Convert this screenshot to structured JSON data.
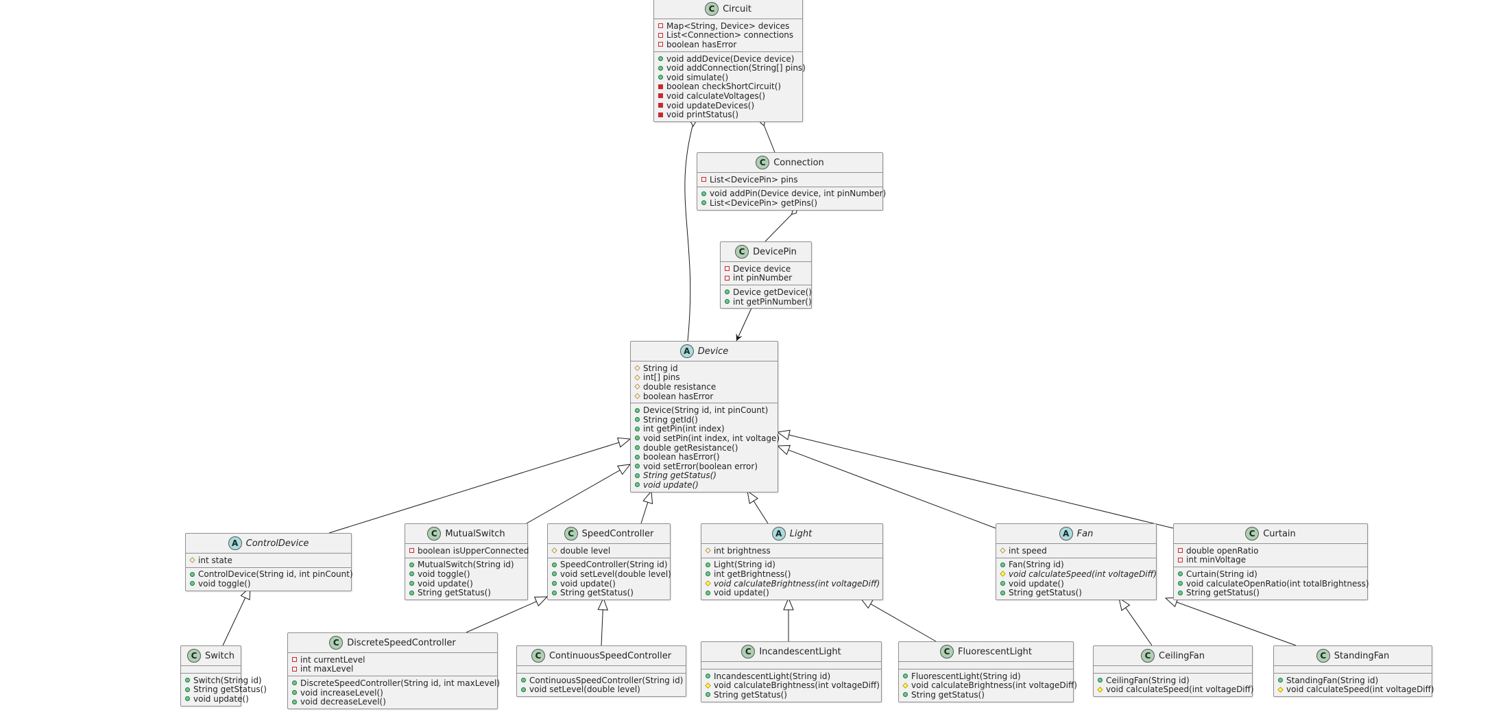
{
  "colors": {
    "class_badge": "#add1b2",
    "abstract_badge": "#a9dcdf",
    "box_fill": "#f1f1f1",
    "border": "#8f8f8f",
    "private": "#c82930",
    "public": "#84be84",
    "protected": "#b38d22"
  },
  "classes": [
    {
      "name": "Circuit",
      "kind": "class",
      "badge": "C",
      "fields": [
        {
          "vis": "private",
          "text": "Map<String, Device> devices"
        },
        {
          "vis": "private",
          "text": "List<Connection> connections"
        },
        {
          "vis": "private",
          "text": "boolean hasError"
        }
      ],
      "methods": [
        {
          "vis": "public",
          "text": "void addDevice(Device device)"
        },
        {
          "vis": "public",
          "text": "void addConnection(String[] pins)"
        },
        {
          "vis": "public",
          "text": "void simulate()"
        },
        {
          "vis": "private",
          "text": "boolean checkShortCircuit()"
        },
        {
          "vis": "private",
          "text": "void calculateVoltages()"
        },
        {
          "vis": "private",
          "text": "void updateDevices()"
        },
        {
          "vis": "private",
          "text": "void printStatus()"
        }
      ]
    },
    {
      "name": "Connection",
      "kind": "class",
      "badge": "C",
      "fields": [
        {
          "vis": "private",
          "text": "List<DevicePin> pins"
        }
      ],
      "methods": [
        {
          "vis": "public",
          "text": "void addPin(Device device, int pinNumber)"
        },
        {
          "vis": "public",
          "text": "List<DevicePin> getPins()"
        }
      ]
    },
    {
      "name": "DevicePin",
      "kind": "class",
      "badge": "C",
      "fields": [
        {
          "vis": "private",
          "text": "Device device"
        },
        {
          "vis": "private",
          "text": "int pinNumber"
        }
      ],
      "methods": [
        {
          "vis": "public",
          "text": "Device getDevice()"
        },
        {
          "vis": "public",
          "text": "int getPinNumber()"
        }
      ]
    },
    {
      "name": "Device",
      "kind": "abstract",
      "badge": "A",
      "fields": [
        {
          "vis": "protected",
          "text": "String id"
        },
        {
          "vis": "protected",
          "text": "int[] pins"
        },
        {
          "vis": "protected",
          "text": "double resistance"
        },
        {
          "vis": "protected",
          "text": "boolean hasError"
        }
      ],
      "methods": [
        {
          "vis": "public",
          "text": "Device(String id, int pinCount)"
        },
        {
          "vis": "public",
          "text": "String getId()"
        },
        {
          "vis": "public",
          "text": "int getPin(int index)"
        },
        {
          "vis": "public",
          "text": "void setPin(int index, int voltage)"
        },
        {
          "vis": "public",
          "text": "double getResistance()"
        },
        {
          "vis": "public",
          "text": "boolean hasError()"
        },
        {
          "vis": "public",
          "text": "void setError(boolean error)"
        },
        {
          "vis": "public",
          "text": "String getStatus()",
          "abstract": true
        },
        {
          "vis": "public",
          "text": "void update()",
          "abstract": true
        }
      ]
    },
    {
      "name": "ControlDevice",
      "kind": "abstract",
      "badge": "A",
      "fields": [
        {
          "vis": "protected",
          "text": "int state"
        }
      ],
      "methods": [
        {
          "vis": "public",
          "text": "ControlDevice(String id, int pinCount)"
        },
        {
          "vis": "public",
          "text": "void toggle()"
        }
      ]
    },
    {
      "name": "MutualSwitch",
      "kind": "class",
      "badge": "C",
      "fields": [
        {
          "vis": "private",
          "text": "boolean isUpperConnected"
        }
      ],
      "methods": [
        {
          "vis": "public",
          "text": "MutualSwitch(String id)"
        },
        {
          "vis": "public",
          "text": "void toggle()"
        },
        {
          "vis": "public",
          "text": "void update()"
        },
        {
          "vis": "public",
          "text": "String getStatus()"
        }
      ]
    },
    {
      "name": "SpeedController",
      "kind": "class",
      "badge": "C",
      "fields": [
        {
          "vis": "protected",
          "text": "double level"
        }
      ],
      "methods": [
        {
          "vis": "public",
          "text": "SpeedController(String id)"
        },
        {
          "vis": "public",
          "text": "void setLevel(double level)"
        },
        {
          "vis": "public",
          "text": "void update()"
        },
        {
          "vis": "public",
          "text": "String getStatus()"
        }
      ]
    },
    {
      "name": "Light",
      "kind": "abstract",
      "badge": "A",
      "fields": [
        {
          "vis": "protected",
          "text": "int brightness"
        }
      ],
      "methods": [
        {
          "vis": "public",
          "text": "Light(String id)"
        },
        {
          "vis": "public",
          "text": "int getBrightness()"
        },
        {
          "vis": "protected",
          "text": "void calculateBrightness(int voltageDiff)",
          "abstract": true
        },
        {
          "vis": "public",
          "text": "void update()"
        }
      ]
    },
    {
      "name": "Fan",
      "kind": "abstract",
      "badge": "A",
      "fields": [
        {
          "vis": "protected",
          "text": "int speed"
        }
      ],
      "methods": [
        {
          "vis": "public",
          "text": "Fan(String id)"
        },
        {
          "vis": "protected",
          "text": "void calculateSpeed(int voltageDiff)",
          "abstract": true
        },
        {
          "vis": "public",
          "text": "void update()"
        },
        {
          "vis": "public",
          "text": "String getStatus()"
        }
      ]
    },
    {
      "name": "Curtain",
      "kind": "class",
      "badge": "C",
      "fields": [
        {
          "vis": "private",
          "text": "double openRatio"
        },
        {
          "vis": "private",
          "text": "int minVoltage"
        }
      ],
      "methods": [
        {
          "vis": "public",
          "text": "Curtain(String id)"
        },
        {
          "vis": "public",
          "text": "void calculateOpenRatio(int totalBrightness)"
        },
        {
          "vis": "public",
          "text": "String getStatus()"
        }
      ]
    },
    {
      "name": "Switch",
      "kind": "class",
      "badge": "C",
      "fields": [],
      "methods": [
        {
          "vis": "public",
          "text": "Switch(String id)"
        },
        {
          "vis": "public",
          "text": "String getStatus()"
        },
        {
          "vis": "public",
          "text": "void update()"
        }
      ]
    },
    {
      "name": "DiscreteSpeedController",
      "kind": "class",
      "badge": "C",
      "fields": [
        {
          "vis": "private",
          "text": "int currentLevel"
        },
        {
          "vis": "private",
          "text": "int maxLevel"
        }
      ],
      "methods": [
        {
          "vis": "public",
          "text": "DiscreteSpeedController(String id, int maxLevel)"
        },
        {
          "vis": "public",
          "text": "void increaseLevel()"
        },
        {
          "vis": "public",
          "text": "void decreaseLevel()"
        }
      ]
    },
    {
      "name": "ContinuousSpeedController",
      "kind": "class",
      "badge": "C",
      "fields": [],
      "methods": [
        {
          "vis": "public",
          "text": "ContinuousSpeedController(String id)"
        },
        {
          "vis": "public",
          "text": "void setLevel(double level)"
        }
      ]
    },
    {
      "name": "IncandescentLight",
      "kind": "class",
      "badge": "C",
      "fields": [],
      "methods": [
        {
          "vis": "public",
          "text": "IncandescentLight(String id)"
        },
        {
          "vis": "protected",
          "text": "void calculateBrightness(int voltageDiff)"
        },
        {
          "vis": "public",
          "text": "String getStatus()"
        }
      ]
    },
    {
      "name": "FluorescentLight",
      "kind": "class",
      "badge": "C",
      "fields": [],
      "methods": [
        {
          "vis": "public",
          "text": "FluorescentLight(String id)"
        },
        {
          "vis": "protected",
          "text": "void calculateBrightness(int voltageDiff)"
        },
        {
          "vis": "public",
          "text": "String getStatus()"
        }
      ]
    },
    {
      "name": "CeilingFan",
      "kind": "class",
      "badge": "C",
      "fields": [],
      "methods": [
        {
          "vis": "public",
          "text": "CeilingFan(String id)"
        },
        {
          "vis": "protected",
          "text": "void calculateSpeed(int voltageDiff)"
        }
      ]
    },
    {
      "name": "StandingFan",
      "kind": "class",
      "badge": "C",
      "fields": [],
      "methods": [
        {
          "vis": "public",
          "text": "StandingFan(String id)"
        },
        {
          "vis": "protected",
          "text": "void calculateSpeed(int voltageDiff)"
        }
      ]
    }
  ],
  "relations": [
    {
      "type": "aggregation",
      "from": "Circuit",
      "to": "Device"
    },
    {
      "type": "aggregation",
      "from": "Circuit",
      "to": "Connection"
    },
    {
      "type": "aggregation",
      "from": "Connection",
      "to": "DevicePin"
    },
    {
      "type": "association",
      "from": "DevicePin",
      "to": "Device"
    },
    {
      "type": "inheritance",
      "from": "ControlDevice",
      "to": "Device"
    },
    {
      "type": "inheritance",
      "from": "MutualSwitch",
      "to": "Device"
    },
    {
      "type": "inheritance",
      "from": "SpeedController",
      "to": "Device"
    },
    {
      "type": "inheritance",
      "from": "Light",
      "to": "Device"
    },
    {
      "type": "inheritance",
      "from": "Fan",
      "to": "Device"
    },
    {
      "type": "inheritance",
      "from": "Curtain",
      "to": "Device"
    },
    {
      "type": "inheritance",
      "from": "Switch",
      "to": "ControlDevice"
    },
    {
      "type": "inheritance",
      "from": "DiscreteSpeedController",
      "to": "SpeedController"
    },
    {
      "type": "inheritance",
      "from": "ContinuousSpeedController",
      "to": "SpeedController"
    },
    {
      "type": "inheritance",
      "from": "IncandescentLight",
      "to": "Light"
    },
    {
      "type": "inheritance",
      "from": "FluorescentLight",
      "to": "Light"
    },
    {
      "type": "inheritance",
      "from": "CeilingFan",
      "to": "Fan"
    },
    {
      "type": "inheritance",
      "from": "StandingFan",
      "to": "Fan"
    }
  ]
}
